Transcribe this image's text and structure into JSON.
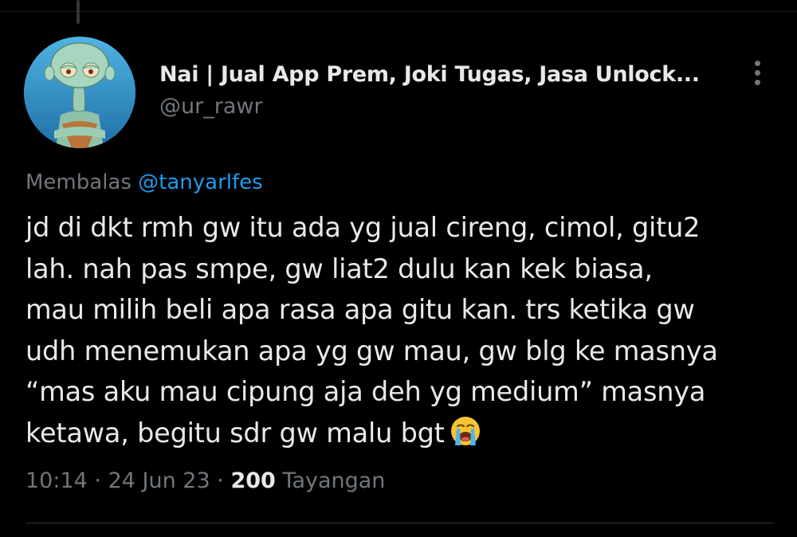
{
  "tweet": {
    "author": {
      "display_name": "Nai | Jual App Prem, Joki Tugas, Jasa Unlock...",
      "handle": "@ur_rawr",
      "avatar_icon": "squidward-avatar"
    },
    "reply_to": {
      "prefix": "Membalas",
      "mention": "@tanyarlfes"
    },
    "text_lines": [
      "jd di dkt rmh gw itu ada yg jual cireng, cimol, gitu2",
      "lah. nah pas smpe, gw liat2 dulu kan kek biasa,",
      "mau milih beli apa rasa apa gitu kan. trs ketika gw",
      "udh menemukan apa yg gw mau, gw blg ke masnya",
      "“mas aku mau cipung aja deh yg medium” masnya",
      "ketawa, begitu sdr gw malu bgt"
    ],
    "emoji_icon": "loudly-crying-face-icon",
    "time": "10:14",
    "date": "24 Jun 23",
    "separator": "·",
    "views_count": "200",
    "views_label": "Tayangan"
  },
  "colors": {
    "background": "#000000",
    "primary_text": "#e7e9ea",
    "secondary_text": "#71767b",
    "link": "#1d9bf0",
    "divider": "#2f3336"
  }
}
